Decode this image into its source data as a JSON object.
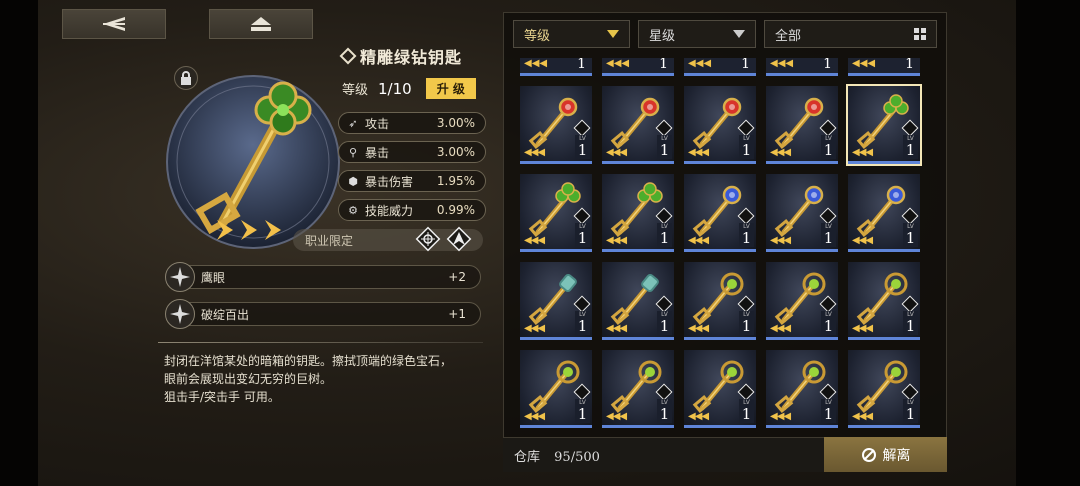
{
  "header": {
    "back_icon": "back-arrow-icon",
    "menu_icon": "eject-icon"
  },
  "item": {
    "name": "精雕绿钻钥匙",
    "level_label": "等级",
    "level_value": "1/10",
    "upgrade_label": "升 级",
    "star_count": 3
  },
  "stats": [
    {
      "icon": "arrow-icon",
      "label": "攻击",
      "value": "3.00%"
    },
    {
      "icon": "crit-icon",
      "label": "暴击",
      "value": "3.00%"
    },
    {
      "icon": "crit-damage-icon",
      "label": "暴击伤害",
      "value": "1.95%"
    },
    {
      "icon": "gear-icon",
      "label": "技能威力",
      "value": "0.99%"
    }
  ],
  "job_restriction": {
    "label": "职业限定",
    "icons": [
      "crosshair-icon",
      "assault-icon"
    ]
  },
  "skills": [
    {
      "name": "鹰眼",
      "value": "+2"
    },
    {
      "name": "破绽百出",
      "value": "+1"
    }
  ],
  "description": {
    "line1": "封闭在洋馆某处的暗箱的钥匙。擦拭顶端的绿色宝石，",
    "line2": "眼前会展现出变幻无穷的巨树。",
    "line3": "狙击手/突击手 可用。"
  },
  "filters": {
    "level": "等级",
    "star": "星级",
    "all": "全部"
  },
  "inventory": {
    "lv_tag": "LV",
    "slots": [
      {
        "gem": "red",
        "level": "1",
        "selected": false
      },
      {
        "gem": "red",
        "level": "1",
        "selected": false
      },
      {
        "gem": "red",
        "level": "1",
        "selected": false
      },
      {
        "gem": "red",
        "level": "1",
        "selected": false
      },
      {
        "gem": "green",
        "level": "1",
        "selected": true
      },
      {
        "gem": "green",
        "level": "1",
        "selected": false
      },
      {
        "gem": "green",
        "level": "1",
        "selected": false
      },
      {
        "gem": "blue",
        "level": "1",
        "selected": false
      },
      {
        "gem": "blue",
        "level": "1",
        "selected": false
      },
      {
        "gem": "blue",
        "level": "1",
        "selected": false
      },
      {
        "gem": "teal",
        "level": "1",
        "selected": false
      },
      {
        "gem": "teal",
        "level": "1",
        "selected": false
      },
      {
        "gem": "ring",
        "level": "1",
        "selected": false
      },
      {
        "gem": "ring",
        "level": "1",
        "selected": false
      },
      {
        "gem": "ring",
        "level": "1",
        "selected": false
      },
      {
        "gem": "ring",
        "level": "1",
        "selected": false
      },
      {
        "gem": "ring",
        "level": "1",
        "selected": false
      },
      {
        "gem": "ring",
        "level": "1",
        "selected": false
      },
      {
        "gem": "ring",
        "level": "1",
        "selected": false
      },
      {
        "gem": "ring",
        "level": "1",
        "selected": false
      }
    ],
    "partial_levels": [
      "1",
      "1",
      "1",
      "1",
      "1"
    ]
  },
  "footer": {
    "storage_label": "仓库",
    "storage_count": "95/500",
    "dismantle_label": "解离"
  }
}
